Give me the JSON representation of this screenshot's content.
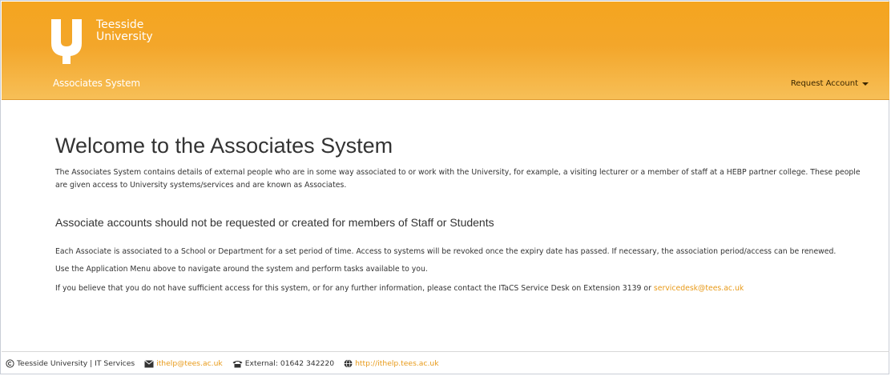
{
  "header": {
    "logo_lines": [
      "Teesside",
      "University"
    ],
    "system_title": "Associates System",
    "request_account_label": "Request Account",
    "colors": {
      "header": "#f3a62a",
      "link": "#e89a19"
    }
  },
  "main": {
    "title": "Welcome to the Associates System",
    "intro": "The Associates System contains details of external people who are in some way associated to or work with the University, for example, a visiting lecturer or a member of staff at a HEBP partner college. These people are given access to University systems/services and are known as Associates.",
    "warning": "Associate accounts should not be requested or created for members of Staff or Students",
    "para_expiry": "Each Associate is associated to a School or Department for a set period of time. Access to systems will be revoked once the expiry date has passed. If necessary, the association period/access can be renewed.",
    "para_menu": "Use the Application Menu above to navigate around the system and perform tasks available to you.",
    "para_contact": "If you believe that you do not have sufficient access for this system, or for any further information, please contact the ITaCS Service Desk on Extension 3139 or ",
    "contact_email": "servicedesk@tees.ac.uk"
  },
  "footer": {
    "copyright": "Teesside University | IT Services",
    "email": "ithelp@tees.ac.uk",
    "external_phone": "External: 01642 342220",
    "website": "http://ithelp.tees.ac.uk"
  }
}
